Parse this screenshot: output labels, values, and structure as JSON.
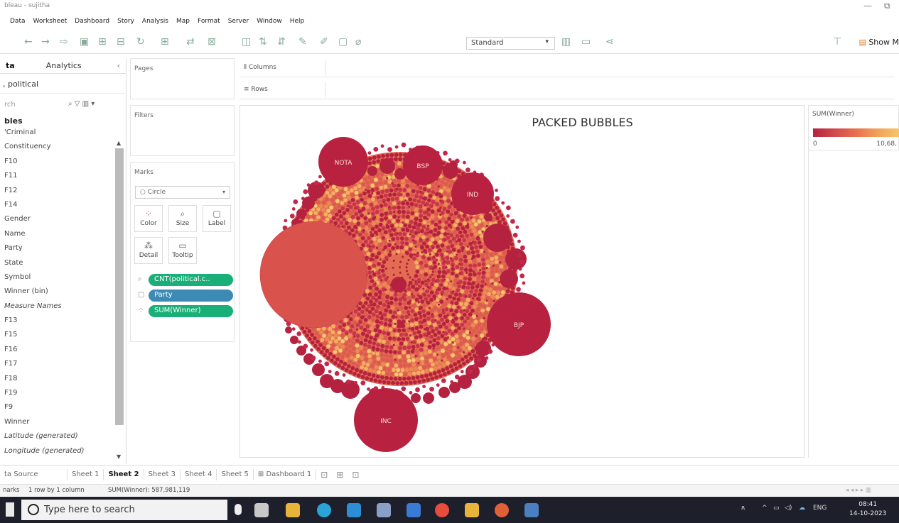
{
  "window": {
    "title": "bleau - sujitha"
  },
  "menu": [
    "Data",
    "Worksheet",
    "Dashboard",
    "Story",
    "Analysis",
    "Map",
    "Format",
    "Server",
    "Window",
    "Help"
  ],
  "toolbar": {
    "fit_select": "Standard",
    "show_me": "Show M"
  },
  "data_pane": {
    "tabs": [
      "ta",
      "Analytics"
    ],
    "source": ", political",
    "search_placeholder": "rch",
    "section": "bles",
    "fields": [
      {
        "label": "'Criminal",
        "italic": false
      },
      {
        "label": "Constituency",
        "italic": false
      },
      {
        "label": "F10",
        "italic": false
      },
      {
        "label": "F11",
        "italic": false
      },
      {
        "label": "F12",
        "italic": false
      },
      {
        "label": "F14",
        "italic": false
      },
      {
        "label": "Gender",
        "italic": false
      },
      {
        "label": "Name",
        "italic": false
      },
      {
        "label": "Party",
        "italic": false
      },
      {
        "label": "State",
        "italic": false
      },
      {
        "label": "Symbol",
        "italic": false
      },
      {
        "label": "Winner (bin)",
        "italic": false
      },
      {
        "label": "Measure Names",
        "italic": true
      },
      {
        "label": "F13",
        "italic": false
      },
      {
        "label": "F15",
        "italic": false
      },
      {
        "label": "F16",
        "italic": false
      },
      {
        "label": "F17",
        "italic": false
      },
      {
        "label": "F18",
        "italic": false
      },
      {
        "label": "F19",
        "italic": false
      },
      {
        "label": "F9",
        "italic": false
      },
      {
        "label": "Winner",
        "italic": false
      },
      {
        "label": "Latitude (generated)",
        "italic": true
      },
      {
        "label": "Longitude (generated)",
        "italic": true
      }
    ]
  },
  "cards": {
    "pages": "Pages",
    "filters": "Filters",
    "marks": "Marks",
    "mark_type": "Circle",
    "buttons": [
      "Color",
      "Size",
      "Label",
      "Detail",
      "Tooltip"
    ],
    "pills": [
      {
        "label": "CNT(political.c..",
        "color": "#1aaf78"
      },
      {
        "label": "Party",
        "color": "#3d8bb5"
      },
      {
        "label": "SUM(Winner)",
        "color": "#1aaf78"
      }
    ]
  },
  "shelves": {
    "columns": "Columns",
    "rows": "Rows"
  },
  "view": {
    "title": "PACKED BUBBLES",
    "bubble_labels": [
      "NOTA",
      "BSP",
      "IND",
      "BJP",
      "INC"
    ]
  },
  "legend": {
    "title": "SUM(Winner)",
    "min": "0",
    "max": "10,68,"
  },
  "sheet_tabs": [
    "ta Source",
    "Sheet 1",
    "Sheet 2",
    "Sheet 3",
    "Sheet 4",
    "Sheet 5",
    "Dashboard 1"
  ],
  "active_sheet": "Sheet 2",
  "status": {
    "marks": "narks",
    "rows_cols": "1 row by 1 column",
    "sum": "SUM(Winner): 587,981,119"
  },
  "taskbar": {
    "search": "Type here to search",
    "lang": "ENG",
    "time": "08:41",
    "date": "14-10-2023"
  }
}
